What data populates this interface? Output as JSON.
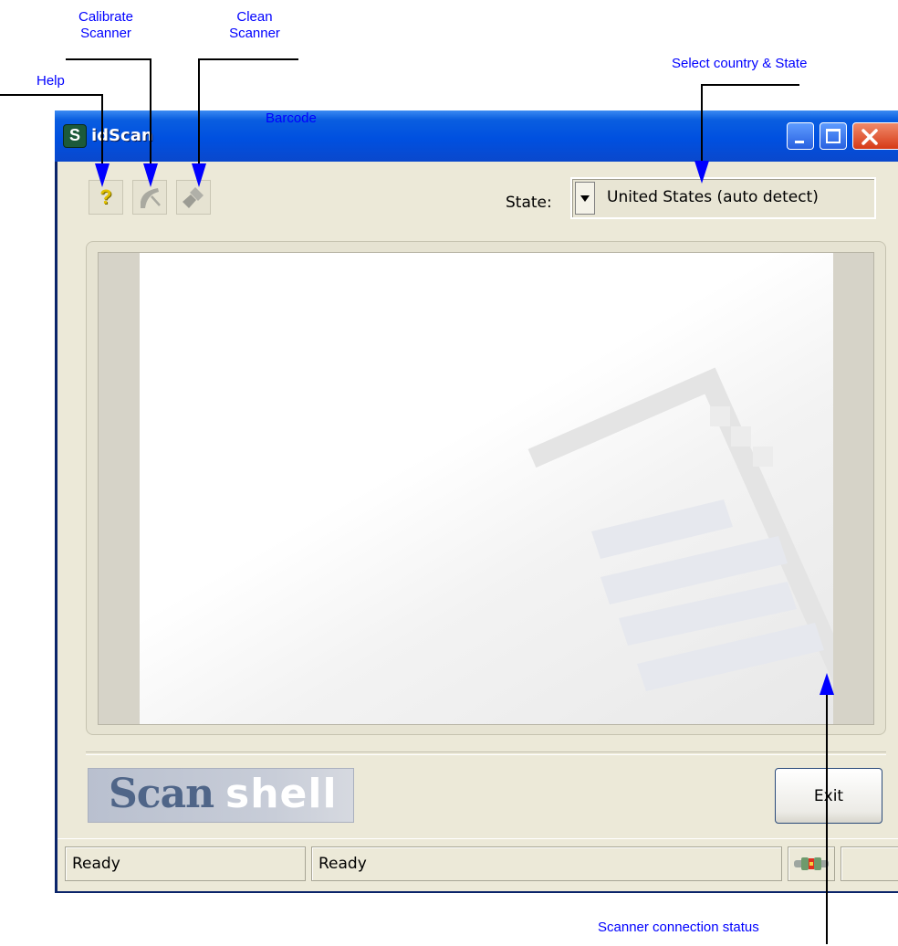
{
  "annotations": {
    "calibrate": "Calibrate Scanner",
    "clean": "Clean Scanner",
    "help": "Help",
    "select_country_state": "Select country & State",
    "barcode": "Barcode",
    "scanner_connection_status": "Scanner connection status"
  },
  "window": {
    "title": "idScan",
    "title_bar_color": "#0050e0",
    "title_buttons": [
      "minimize-icon",
      "maximize-icon",
      "close-icon"
    ]
  },
  "toolbar": {
    "help_icon": "question-mark-icon",
    "calibrate_icon": "calibrate-icon",
    "clean_icon": "brush-icon",
    "state_label": "State:",
    "state_value": "United States (auto detect)"
  },
  "logo": {
    "scan": "Scan",
    "shell": "shell"
  },
  "footer": {
    "exit_label": "Exit"
  },
  "statusbar": {
    "panel1": "Ready",
    "panel2": "Ready",
    "connection_icon": "scanner-connection-icon"
  },
  "colors": {
    "annotation_text": "#0000ff",
    "window_bg": "#ece9d8",
    "close_button": "#d63a16"
  }
}
